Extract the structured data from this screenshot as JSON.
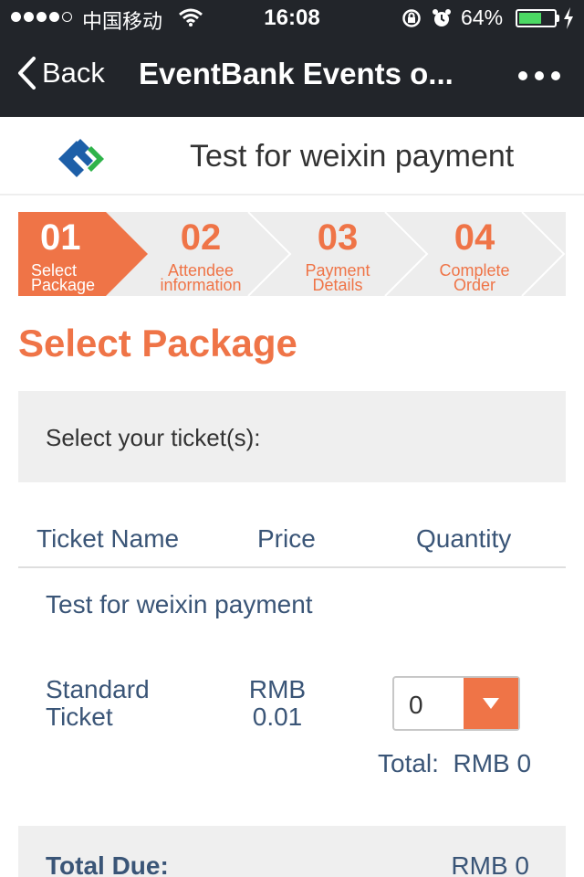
{
  "status_bar": {
    "carrier": "中国移动",
    "time": "16:08",
    "battery_percent": "64%",
    "battery_level": 0.64
  },
  "nav": {
    "back_label": "Back",
    "title": "EventBank Events o..."
  },
  "event": {
    "title": "Test for weixin payment"
  },
  "steps": [
    {
      "num": "01",
      "line1": "Select",
      "line2": "Package",
      "active": true
    },
    {
      "num": "02",
      "line1": "Attendee",
      "line2": "information",
      "active": false
    },
    {
      "num": "03",
      "line1": "Payment",
      "line2": "Details",
      "active": false
    },
    {
      "num": "04",
      "line1": "Complete",
      "line2": "Order",
      "active": false
    }
  ],
  "section_title": "Select Package",
  "ticket_prompt": "Select your ticket(s):",
  "table": {
    "headers": [
      "Ticket Name",
      "Price",
      "Quantity"
    ],
    "package_name": "Test for weixin payment",
    "rows": [
      {
        "name_line1": "Standard",
        "name_line2": "Ticket",
        "price_line1": "RMB",
        "price_line2": "0.01",
        "quantity": "0",
        "total_label": "Total:",
        "total_value": "RMB 0"
      }
    ]
  },
  "summary": {
    "label": "Total Due:",
    "amount": "RMB 0"
  },
  "colors": {
    "accent": "#ef7447",
    "text_blue": "#3a5577",
    "nav_bg": "#22252a"
  }
}
